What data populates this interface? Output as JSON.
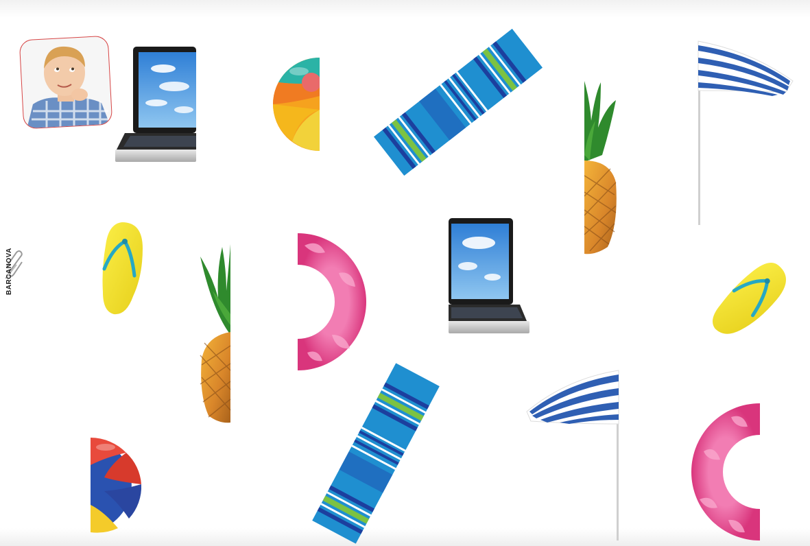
{
  "brand": {
    "name": "BARCANOVA",
    "icon": "paperclip-icon"
  },
  "avatar": {
    "icon": "child-avatar",
    "border_color": "#d64545"
  },
  "cards": [
    {
      "id": "laptop-1",
      "icon": "laptop-icon"
    },
    {
      "id": "beach-ball-1",
      "icon": "beach-ball-icon"
    },
    {
      "id": "beach-towel-1",
      "icon": "beach-towel-icon"
    },
    {
      "id": "pineapple-1",
      "icon": "pineapple-icon"
    },
    {
      "id": "umbrella-1",
      "icon": "beach-umbrella-icon"
    },
    {
      "id": "flip-flop-1",
      "icon": "flip-flop-icon"
    },
    {
      "id": "pineapple-2",
      "icon": "pineapple-icon"
    },
    {
      "id": "swim-ring-1",
      "icon": "swim-ring-icon"
    },
    {
      "id": "laptop-2",
      "icon": "laptop-icon"
    },
    {
      "id": "flip-flop-2",
      "icon": "flip-flop-icon"
    },
    {
      "id": "beach-ball-2",
      "icon": "beach-ball-icon"
    },
    {
      "id": "beach-towel-2",
      "icon": "beach-towel-icon"
    },
    {
      "id": "umbrella-2",
      "icon": "beach-umbrella-icon"
    },
    {
      "id": "swim-ring-2",
      "icon": "swim-ring-icon"
    }
  ],
  "colors": {
    "towel_blue": "#1f8fd0",
    "towel_navy": "#1c3f9e",
    "towel_green": "#7cc242",
    "flip_yellow": "#f2e22c",
    "flip_strap": "#27a8c4",
    "ring_pink": "#e8468e",
    "umbrella_blue": "#2f5fb3"
  }
}
